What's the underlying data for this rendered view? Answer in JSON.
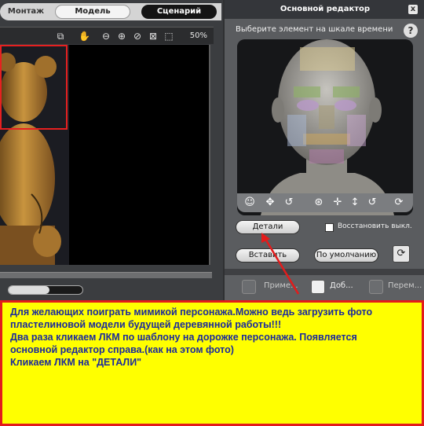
{
  "mode_tabs": {
    "montage": "Монтаж",
    "model": "Модель",
    "scenario": "Сценарий"
  },
  "viewport": {
    "zoom": "50%"
  },
  "transport": {
    "volume_level": 0.55
  },
  "editor": {
    "title": "Основной редактор",
    "prompt": "Выберите элемент на шкале времени",
    "details_label": "Детали",
    "restore_label": "Восстановить выкл.",
    "insert_label": "Вставить",
    "default_label": "По умолчанию",
    "bottom": {
      "item1": "Приме...",
      "item2": "Доб...",
      "item3": "Перем..."
    }
  },
  "annotation": {
    "line1": "Для желающих поиграть мимикой персонажа.Можно ведь загрузить фото",
    "line2": "пластелиновой модели будущей деревянной работы!!!",
    "line3": "Два раза кликаем ЛКМ  по шаблону  на дорожке персонажа. Появляется",
    "line4": "основной редактор справа.(как на этом фото)",
    "line5": "Кликаем ЛКМ на \"ДЕТАЛИ\""
  },
  "colors": {
    "annotation_bg": "#ffff00",
    "annotation_border": "#e31b1b",
    "annotation_text": "#1b2a9c",
    "selection_box": "#e62020"
  },
  "icons": [
    "hand-icon",
    "zoom-out-icon",
    "zoom-in-icon",
    "no-entry-icon",
    "fit-icon",
    "crop-icon",
    "rotate-icon",
    "move-icon",
    "refresh-icon",
    "help-icon",
    "close-icon"
  ]
}
